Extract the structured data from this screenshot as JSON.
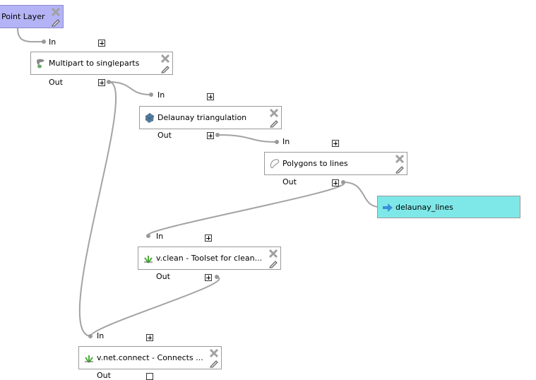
{
  "canvas": {
    "edge_color": "#a3a3a3",
    "input_color": "#b3b3f5",
    "output_color": "#7ee8e8"
  },
  "nodes": {
    "point_layer": {
      "label": "Point Layer",
      "type": "input"
    },
    "multipart": {
      "label": "Multipart to singleparts",
      "in_label": "In",
      "out_label": "Out"
    },
    "delaunay": {
      "label": "Delaunay triangulation",
      "in_label": "In",
      "out_label": "Out"
    },
    "polygons_to_lines": {
      "label": "Polygons to lines",
      "in_label": "In",
      "out_label": "Out"
    },
    "delaunay_lines": {
      "label": "delaunay_lines",
      "type": "output"
    },
    "vclean": {
      "label": "v.clean - Toolset for clean...",
      "in_label": "In",
      "out_label": "Out"
    },
    "vnetconnect": {
      "label": "v.net.connect - Connects ...",
      "in_label": "In",
      "out_label": "Out"
    }
  },
  "icons": {
    "delete": "close-icon",
    "edit": "pencil-icon"
  }
}
